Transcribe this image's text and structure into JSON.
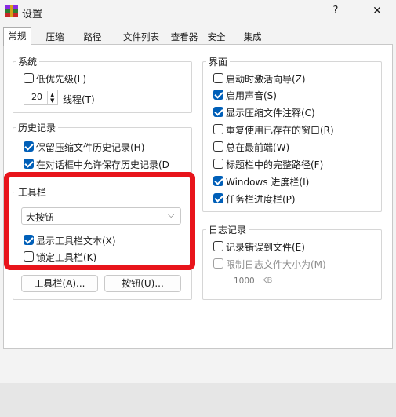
{
  "window": {
    "title": "设置",
    "help": "?",
    "close": "✕"
  },
  "tabs": [
    "常规",
    "压缩",
    "路径",
    "文件列表",
    "查看器",
    "安全",
    "集成"
  ],
  "system": {
    "title": "系统",
    "low_priority": "低优先级(L)",
    "threads_value": "20",
    "threads_label": "线程(T)"
  },
  "history": {
    "title": "历史记录",
    "keep_archive_history": "保留压缩文件历史记录(H)",
    "allow_dialog_history": "在对话框中允许保存历史记录(D"
  },
  "toolbar": {
    "title": "工具栏",
    "size_value": "大按钮",
    "show_text": "显示工具栏文本(X)",
    "lock": "锁定工具栏(K)",
    "toolbar_btn": "工具栏(A)...",
    "buttons_btn": "按钮(U)..."
  },
  "interface": {
    "title": "界面",
    "items": [
      {
        "label": "启动时激活向导(Z)",
        "checked": false
      },
      {
        "label": "启用声音(S)",
        "checked": true
      },
      {
        "label": "显示压缩文件注释(C)",
        "checked": true
      },
      {
        "label": "重复使用已存在的窗口(R)",
        "checked": false
      },
      {
        "label": "总在最前端(W)",
        "checked": false
      },
      {
        "label": "标题栏中的完整路径(F)",
        "checked": false
      },
      {
        "label": "Windows 进度栏(I)",
        "checked": true
      },
      {
        "label": "任务栏进度栏(P)",
        "checked": true
      }
    ]
  },
  "log": {
    "title": "日志记录",
    "log_errors": "记录错误到文件(E)",
    "limit_size": "限制日志文件大小为(M)",
    "size_value": "1000",
    "size_unit": "KB"
  }
}
